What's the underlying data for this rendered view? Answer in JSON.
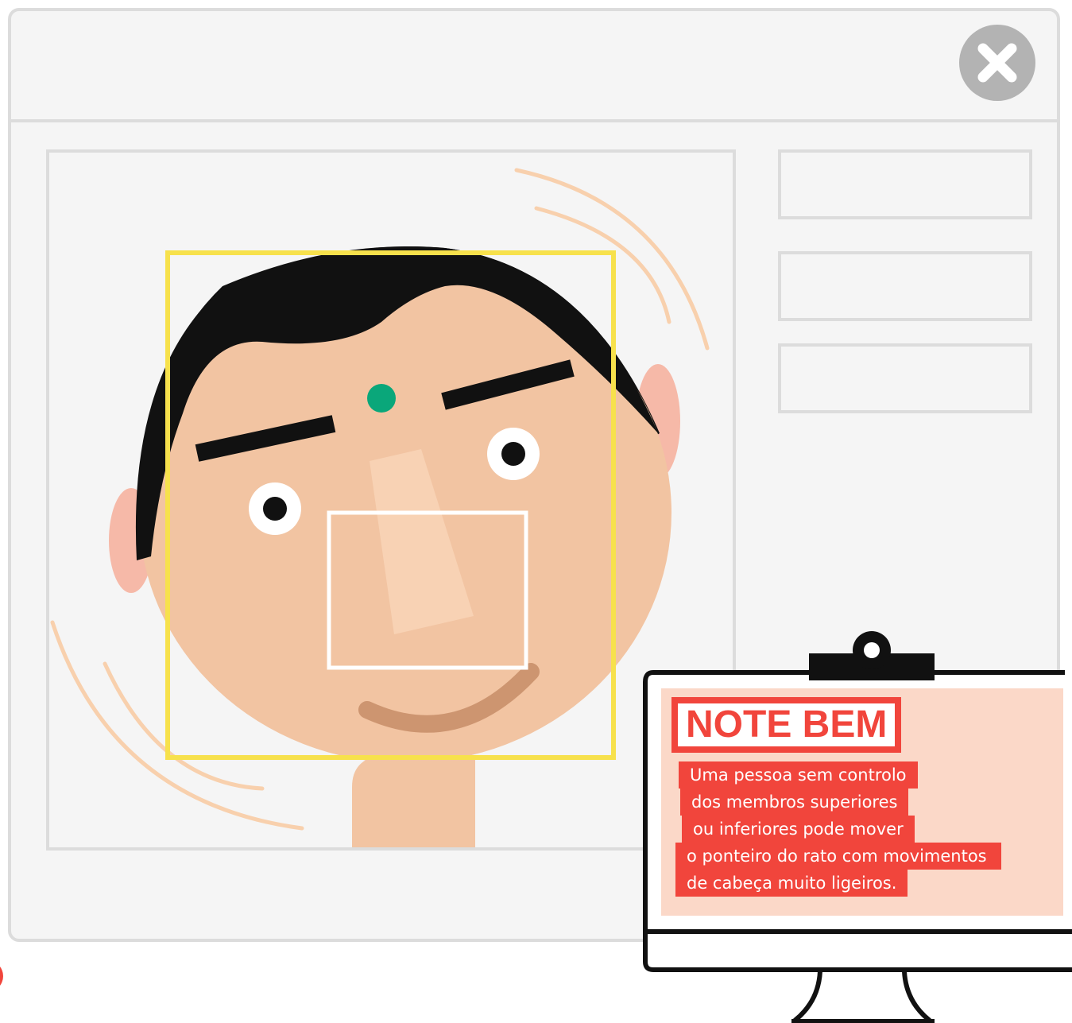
{
  "window": {
    "close_button_icon": "close-x-icon"
  },
  "sidebar": {
    "boxes": [
      "",
      "",
      ""
    ]
  },
  "note": {
    "title": "NOTE BEM",
    "lines": [
      "Uma pessoa sem controlo",
      "dos membros superiores",
      "ou inferiores pode mover",
      "o ponteiro do rato com movimentos",
      "de cabeça muito ligeiros."
    ]
  },
  "colors": {
    "accent_red": "#f1453c",
    "face_detection_box": "#f7e14c",
    "tracking_dot": "#0aa77a",
    "skin": "#f2c4a2",
    "window_border": "#dcdcdc"
  }
}
